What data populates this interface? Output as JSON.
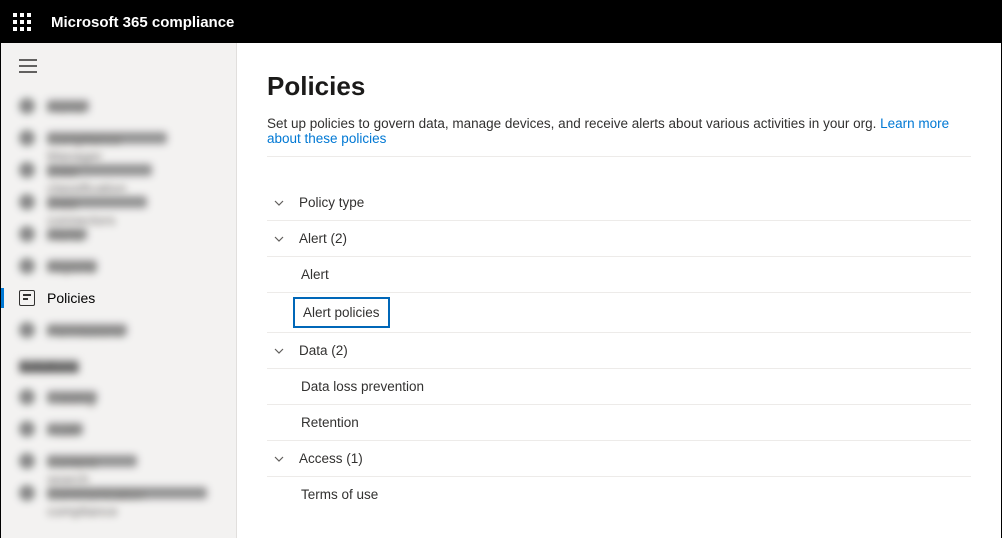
{
  "header": {
    "app_title": "Microsoft 365 compliance"
  },
  "sidebar": {
    "items": [
      {
        "label": "Home"
      },
      {
        "label": "Compliance Manager"
      },
      {
        "label": "Data classification"
      },
      {
        "label": "Data connectors"
      },
      {
        "label": "Alerts"
      },
      {
        "label": "Reports"
      },
      {
        "label": "Policies",
        "active": true
      },
      {
        "label": "Permissions"
      }
    ],
    "section_label": "Solutions",
    "solutions": [
      {
        "label": "Catalog"
      },
      {
        "label": "Audit"
      },
      {
        "label": "Content search"
      },
      {
        "label": "Communication compliance"
      }
    ]
  },
  "page": {
    "title": "Policies",
    "description": "Set up policies to govern data, manage devices, and receive alerts about various activities in your org. ",
    "learn_more": "Learn more about these policies"
  },
  "groups": {
    "type_label": "Policy type",
    "alert": {
      "label": "Alert (2)",
      "items": [
        "Alert",
        "Alert policies"
      ],
      "highlighted": "Alert policies"
    },
    "data": {
      "label": "Data (2)",
      "items": [
        "Data loss prevention",
        "Retention"
      ]
    },
    "access": {
      "label": "Access (1)",
      "items": [
        "Terms of use"
      ]
    }
  }
}
